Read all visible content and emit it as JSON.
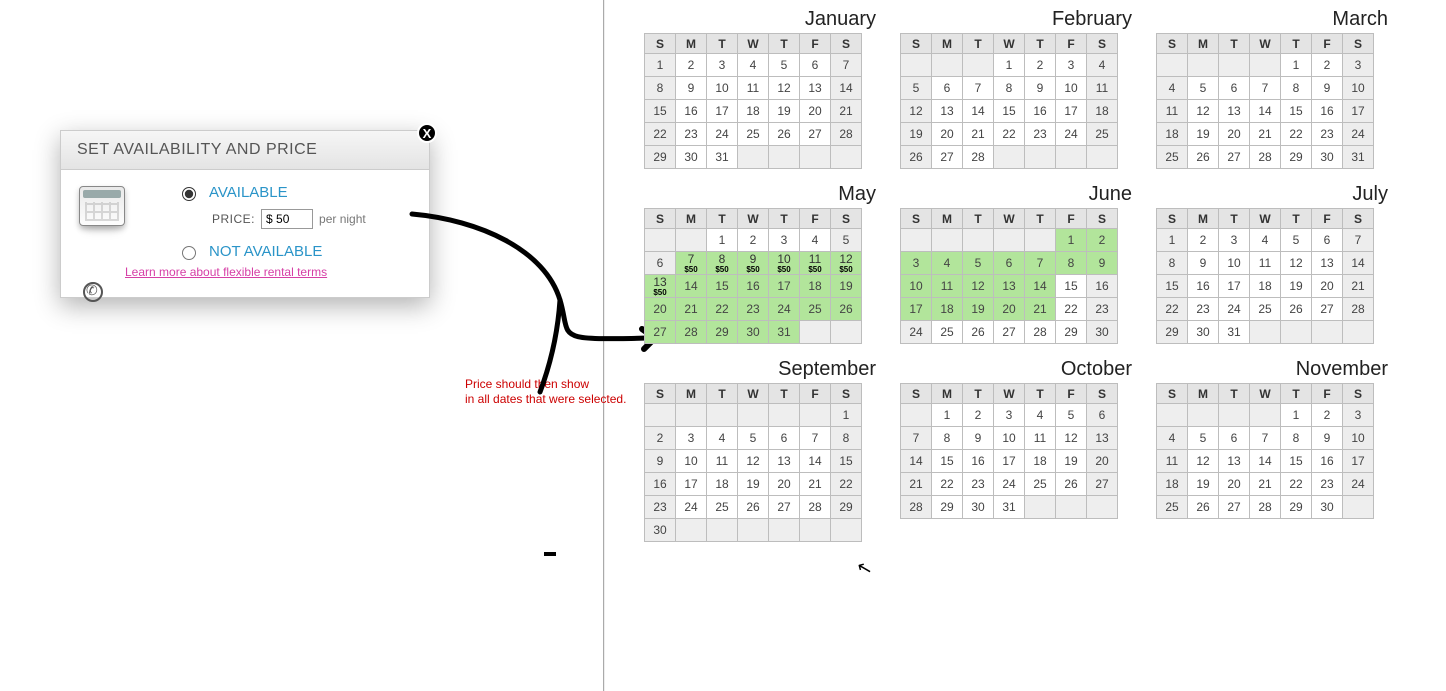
{
  "dialog": {
    "title": "SET AVAILABILITY AND PRICE",
    "available_label": "AVAILABLE",
    "not_available_label": "NOT AVAILABLE",
    "price_label": "PRICE:",
    "price_value": "$ 50",
    "per_night": "per night",
    "learn_more": "Learn more about flexible rental terms",
    "availability_selected": "available"
  },
  "annotation": {
    "line1": "Price should then show",
    "line2": "in all dates that were selected."
  },
  "price_tag": "$50",
  "dow": [
    "S",
    "M",
    "T",
    "W",
    "T",
    "F",
    "S"
  ],
  "months": [
    {
      "name": "January",
      "start": 0,
      "days": 31,
      "priced_days": [],
      "selected_days": []
    },
    {
      "name": "February",
      "start": 3,
      "days": 28,
      "priced_days": [],
      "selected_days": []
    },
    {
      "name": "March",
      "start": 4,
      "days": 31,
      "priced_days": [],
      "selected_days": []
    },
    {
      "name": "May",
      "start": 2,
      "days": 31,
      "priced_days": [
        7,
        8,
        9,
        10,
        11,
        12,
        13
      ],
      "selected_days": [
        7,
        8,
        9,
        10,
        11,
        12,
        13,
        14,
        15,
        16,
        17,
        18,
        19,
        20,
        21,
        22,
        23,
        24,
        25,
        26,
        27,
        28,
        29,
        30,
        31
      ]
    },
    {
      "name": "June",
      "start": 5,
      "days": 30,
      "priced_days": [],
      "selected_days": [
        1,
        2,
        3,
        4,
        5,
        6,
        7,
        8,
        9,
        10,
        11,
        12,
        13,
        14,
        17,
        18,
        19,
        20,
        21
      ]
    },
    {
      "name": "July",
      "start": 0,
      "days": 31,
      "priced_days": [],
      "selected_days": []
    },
    {
      "name": "September",
      "start": 6,
      "days": 30,
      "priced_days": [],
      "selected_days": []
    },
    {
      "name": "October",
      "start": 1,
      "days": 31,
      "priced_days": [],
      "selected_days": []
    },
    {
      "name": "November",
      "start": 4,
      "days": 30,
      "priced_days": [],
      "selected_days": []
    }
  ]
}
